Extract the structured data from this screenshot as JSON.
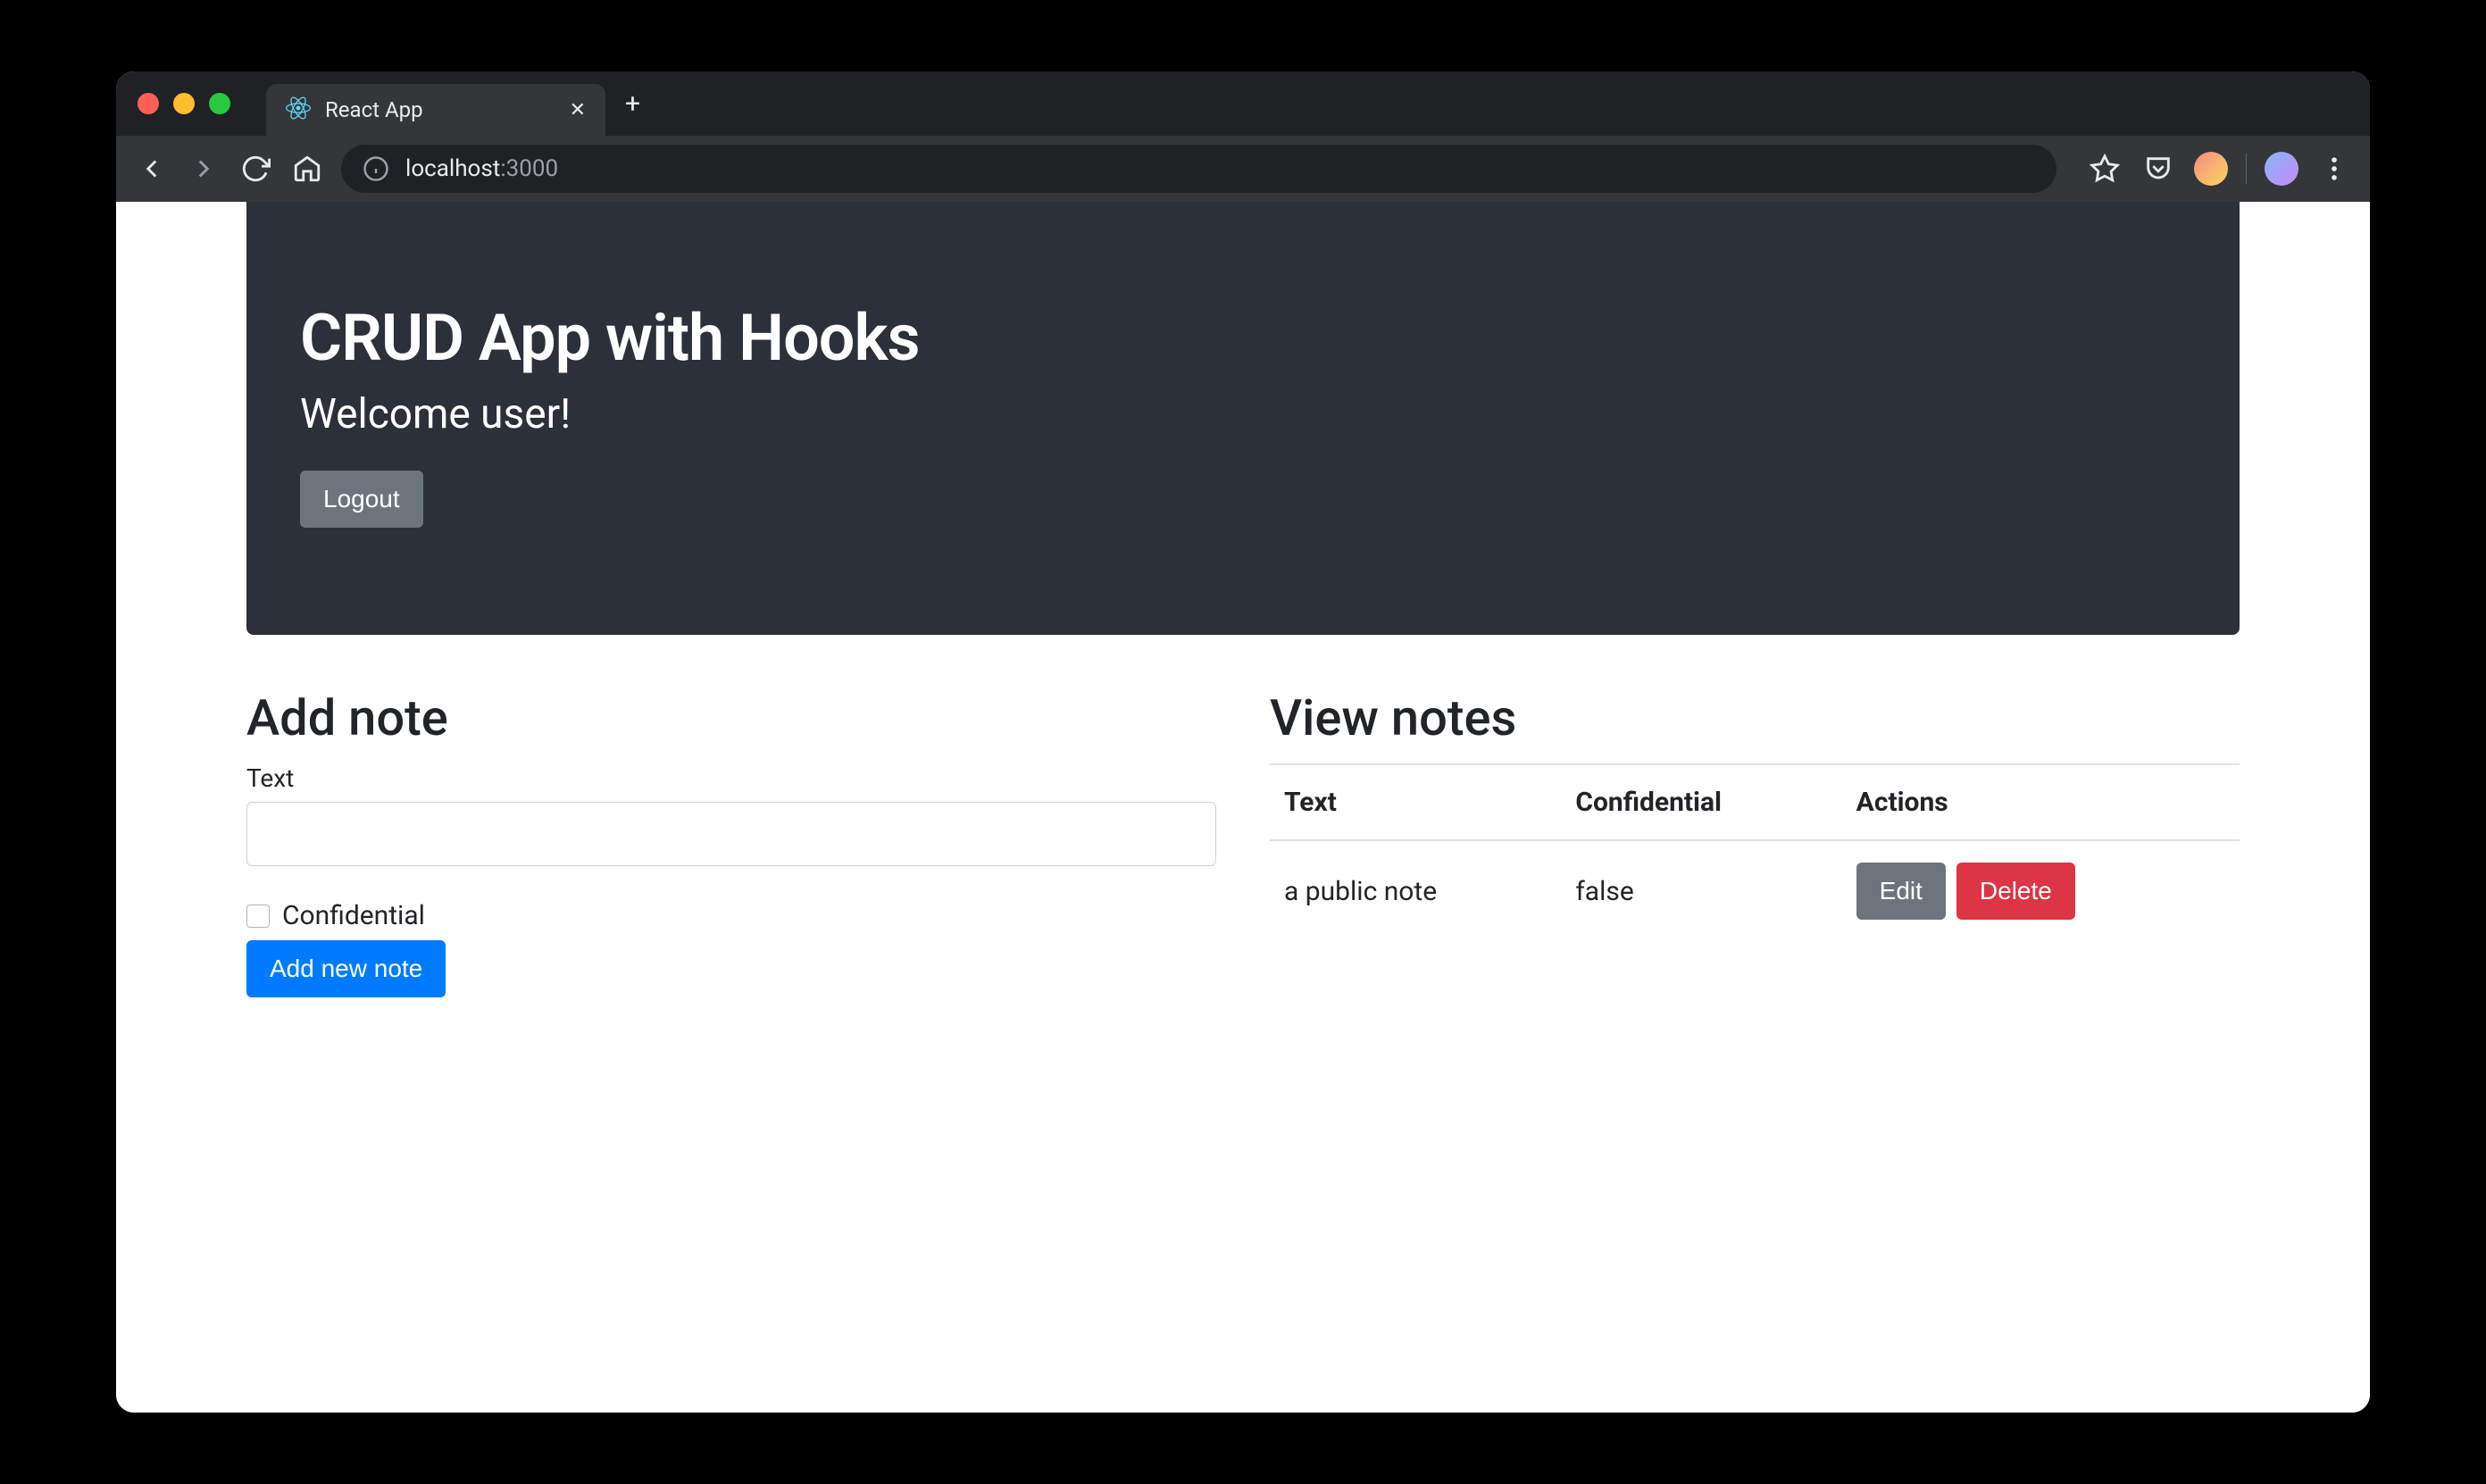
{
  "browser": {
    "tab_title": "React App",
    "url_host": "localhost",
    "url_port": ":3000"
  },
  "hero": {
    "title": "CRUD App with Hooks",
    "welcome": "Welcome user!",
    "logout_label": "Logout"
  },
  "add": {
    "heading": "Add note",
    "text_label": "Text",
    "text_value": "",
    "confidential_label": "Confidential",
    "submit_label": "Add new note"
  },
  "view": {
    "heading": "View notes",
    "columns": {
      "text": "Text",
      "confidential": "Confidential",
      "actions": "Actions"
    },
    "rows": [
      {
        "text": "a public note",
        "confidential": "false"
      }
    ],
    "edit_label": "Edit",
    "delete_label": "Delete"
  }
}
